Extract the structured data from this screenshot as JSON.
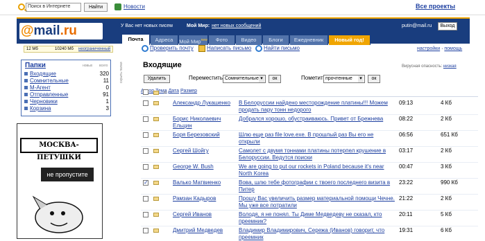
{
  "topbar": {
    "search_placeholder": "Поиск в Интернете",
    "search_button": "Найти",
    "news": "Новости",
    "all_projects": "Все проекты"
  },
  "header": {
    "logo_at": "@",
    "logo_main": "mail",
    "logo_ru": ".ru",
    "no_new": "У Вас нет новых писем",
    "mymir_label": "Мой Мир:",
    "mymir_link": "нет новых сообщений",
    "email": "putin@mail.ru",
    "exit": "Выход",
    "tabs": [
      {
        "label": "Почта",
        "active": true
      },
      {
        "label": "Адреса"
      },
      {
        "label": "Мой Мир",
        "sup": "new"
      },
      {
        "label": "Фото"
      },
      {
        "label": "Видео"
      },
      {
        "label": "Блоги"
      },
      {
        "label": "Ежедневник"
      },
      {
        "label": "Новый год!"
      }
    ]
  },
  "quota": {
    "used": "12 Мб",
    "total": "10240 Мб",
    "link": "неограниченный"
  },
  "tools": {
    "check": "Проверить почту",
    "write": "Написать письмо",
    "find": "Найти письмо",
    "settings": "настройки",
    "help": "помощь"
  },
  "folders": {
    "title": "Папки",
    "col_new": "новых",
    "col_total": "всего",
    "items": [
      {
        "name": "Входящие",
        "new": "",
        "total": "320"
      },
      {
        "name": "Сомнительные",
        "new": "",
        "total": "11"
      },
      {
        "name": "М-Агент",
        "new": "",
        "total": "0"
      },
      {
        "name": "Отправленные",
        "new": "",
        "total": "91"
      },
      {
        "name": "Черновики",
        "new": "",
        "total": "1"
      },
      {
        "name": "Корзина",
        "new": "",
        "total": "3"
      }
    ],
    "side_link": "скрыть папки"
  },
  "ad": {
    "banner": "МОСКВА-ПЕТУШКИ",
    "button": "не пропустите"
  },
  "inbox": {
    "title": "Входящие",
    "virus_label": "Вирусная опасность:",
    "virus_level": "низкая",
    "delete": "Удалить",
    "move_label": "Переместить в",
    "move_value": "Сомнительные",
    "ok": "ок",
    "mark_label": "Пометить",
    "mark_value": "прочтенные",
    "columns": {
      "author": "Автор",
      "subject": "Тема",
      "date": "Дата",
      "size": "Размер"
    },
    "rows": [
      {
        "author": "Александр Лукашенко",
        "subject": "В Белоруссии найдено месторождение платины!!! Можем продать пару тонн недорого",
        "date": "09:13",
        "size": "4 Кб",
        "checked": false
      },
      {
        "author": "Борис Николаевич Ельцин",
        "subject": "Добрался хорошо, обустраиваюсь. Привет от Брежнева",
        "date": "08:22",
        "size": "2 Кб",
        "checked": false
      },
      {
        "author": "Боря Березовский",
        "subject": "Шлю еще раз file love.exe. В прошлый раз Вы его не открыли",
        "date": "06:56",
        "size": "651 Кб",
        "checked": false
      },
      {
        "author": "Сергей Шойгу",
        "subject": "Самолет с двумя тоннами платины потерпел крушение в Белоруссии. Ведутся поиски",
        "date": "03:17",
        "size": "2 Кб",
        "checked": false
      },
      {
        "author": "George W. Bush",
        "subject": "We are going to put our rockets in Poland because it's near North Korea",
        "date": "00:47",
        "size": "3 Кб",
        "checked": false
      },
      {
        "author": "Валько Матвиенко",
        "subject": "Вова, шлю тебе фотографии с твоего последнего визита в Питер",
        "date": "23:22",
        "size": "990 Кб",
        "checked": true
      },
      {
        "author": "Рамзан Кадыров",
        "subject": "Прошу Вас увеличить размер материальной помощи Чечне. Мы уже все потратили",
        "date": "21:22",
        "size": "2 Кб",
        "checked": false
      },
      {
        "author": "Сергей Иванов",
        "subject": "Володя, я не понял. Ты Диме Медведеву не сказал, кто преемник?",
        "date": "20:11",
        "size": "5 Кб",
        "checked": false
      },
      {
        "author": "Дмитрий Медведев",
        "subject": "Владимир Владимирович, Сережа (Иванов) говорит, что преемник",
        "date": "19:31",
        "size": "6 Кб",
        "checked": false
      }
    ]
  }
}
